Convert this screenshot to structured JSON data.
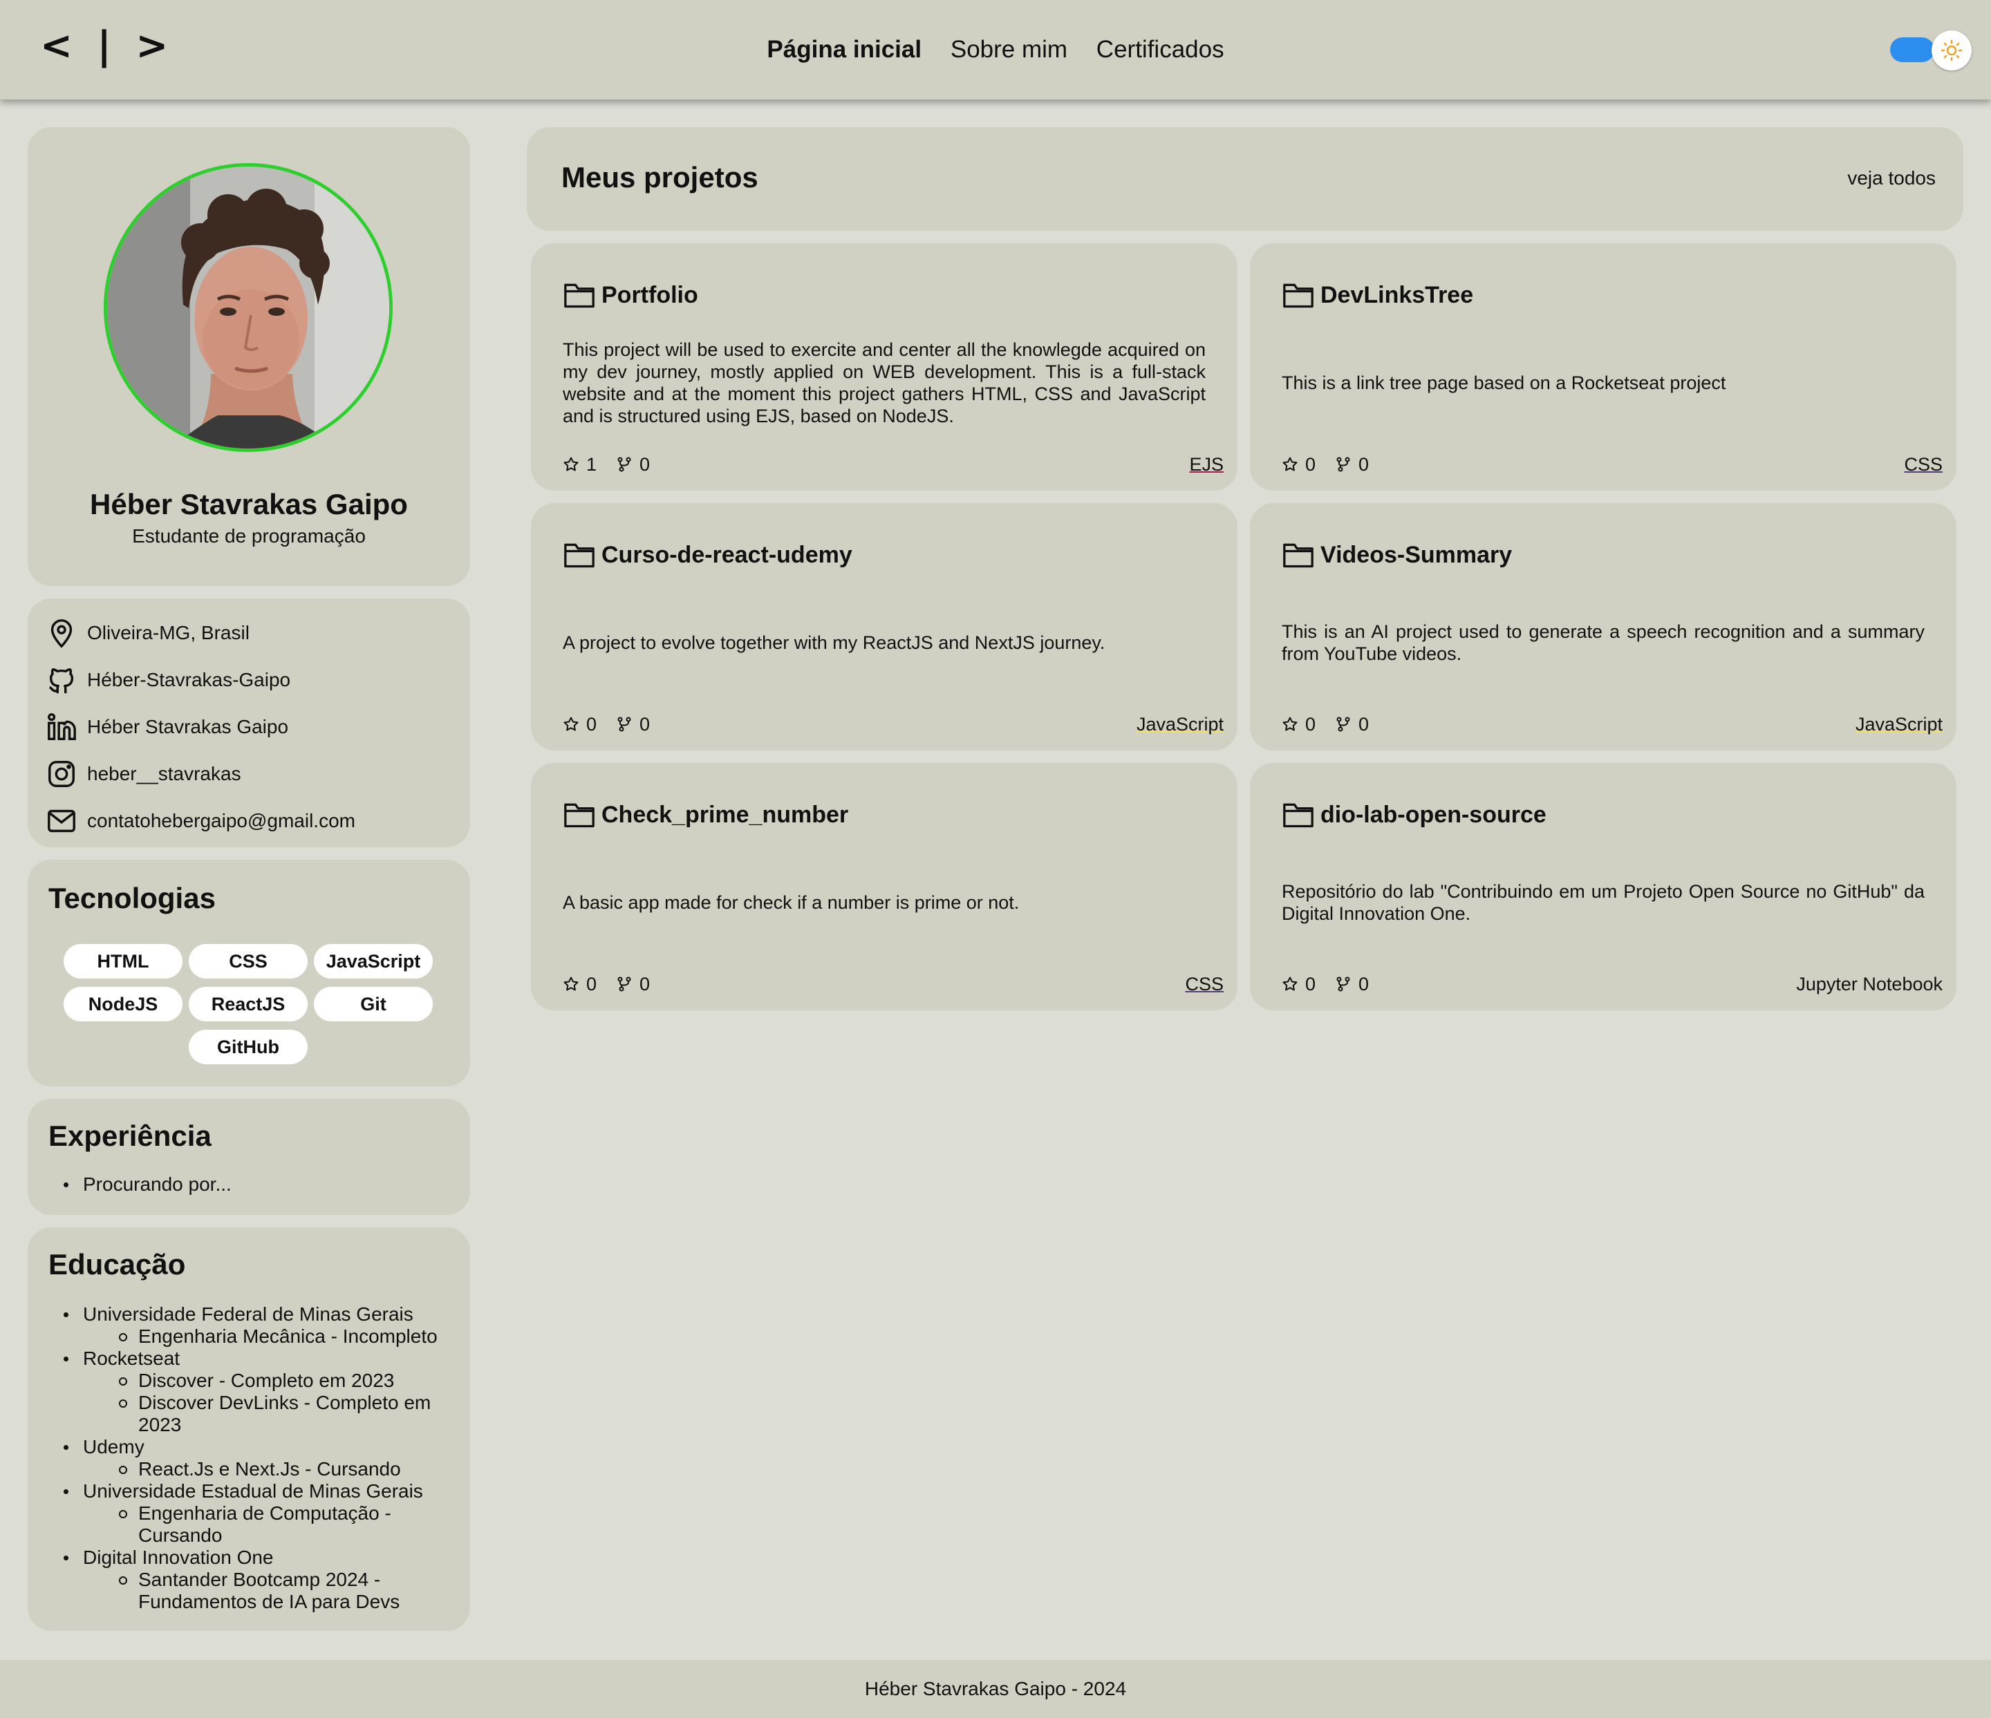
{
  "header": {
    "logo": "< | >",
    "nav": [
      {
        "label": "Página inicial",
        "active": true
      },
      {
        "label": "Sobre mim",
        "active": false
      },
      {
        "label": "Certificados",
        "active": false
      }
    ],
    "theme_toggle": {
      "state": "on",
      "icon": "sun-icon",
      "track_color": "#2c8ff0",
      "icon_color": "#f0a020"
    }
  },
  "profile": {
    "name": "Héber Stavrakas Gaipo",
    "role": "Estudante de programação",
    "avatar_border_color": "#2ccf2c"
  },
  "contacts": [
    {
      "icon": "map-pin-icon",
      "text": "Oliveira-MG, Brasil"
    },
    {
      "icon": "github-icon",
      "text": "Héber-Stavrakas-Gaipo"
    },
    {
      "icon": "linkedin-icon",
      "text": "Héber Stavrakas Gaipo"
    },
    {
      "icon": "instagram-icon",
      "text": "heber__stavrakas"
    },
    {
      "icon": "mail-icon",
      "text": "contatohebergaipo@gmail.com"
    }
  ],
  "technologies": {
    "title": "Tecnologias",
    "items": [
      "HTML",
      "CSS",
      "JavaScript",
      "NodeJS",
      "ReactJS",
      "Git",
      "GitHub"
    ]
  },
  "experience": {
    "title": "Experiência",
    "items": [
      "Procurando por..."
    ]
  },
  "education": {
    "title": "Educação",
    "items": [
      {
        "name": "Universidade Federal de Minas Gerais",
        "sub": [
          "Engenharia Mecânica - Incompleto"
        ]
      },
      {
        "name": "Rocketseat",
        "sub": [
          "Discover - Completo em 2023",
          "Discover DevLinks - Completo em 2023"
        ]
      },
      {
        "name": "Udemy",
        "sub": [
          "React.Js e Next.Js - Cursando"
        ]
      },
      {
        "name": "Universidade Estadual de Minas Gerais",
        "sub": [
          "Engenharia de Computação - Cursando"
        ]
      },
      {
        "name": "Digital Innovation One",
        "sub": [
          "Santander Bootcamp 2024 - Fundamentos de IA para Devs"
        ]
      }
    ]
  },
  "projects": {
    "title": "Meus projetos",
    "see_all": "veja todos",
    "repos": [
      {
        "name": "Portfolio",
        "description": "This project will be used to exercite and center all the knowlegde acquired on my dev journey, mostly applied on WEB development. This is a full-stack website and at the moment this project gathers HTML, CSS and JavaScript and is structured using EJS, based on NodeJS.",
        "stars": "1",
        "forks": "0",
        "language": "EJS",
        "lang_color": "#a91e50"
      },
      {
        "name": "DevLinksTree",
        "description": "This is a link tree page based on a Rocketseat project",
        "stars": "0",
        "forks": "0",
        "language": "CSS",
        "lang_color": "#563d7c"
      },
      {
        "name": "Curso-de-react-udemy",
        "description": "A project to evolve together with my ReactJS and NextJS journey.",
        "stars": "0",
        "forks": "0",
        "language": "JavaScript",
        "lang_color": "#f1e05a"
      },
      {
        "name": "Videos-Summary",
        "description": "This is an AI project used to generate a speech recognition and a summary from YouTube videos.",
        "stars": "0",
        "forks": "0",
        "language": "JavaScript",
        "lang_color": "#f1e05a"
      },
      {
        "name": "Check_prime_number",
        "description": "A basic app made for check if a number is prime or not.",
        "stars": "0",
        "forks": "0",
        "language": "CSS",
        "lang_color": "#563d7c"
      },
      {
        "name": "dio-lab-open-source",
        "description": "Repositório do lab \"Contribuindo em um Projeto Open Source no GitHub\" da Digital Innovation One.",
        "stars": "0",
        "forks": "0",
        "language": "Jupyter Notebook",
        "lang_color": "#da5b0b"
      }
    ]
  },
  "footer": {
    "text": "Héber Stavrakas Gaipo - 2024"
  }
}
